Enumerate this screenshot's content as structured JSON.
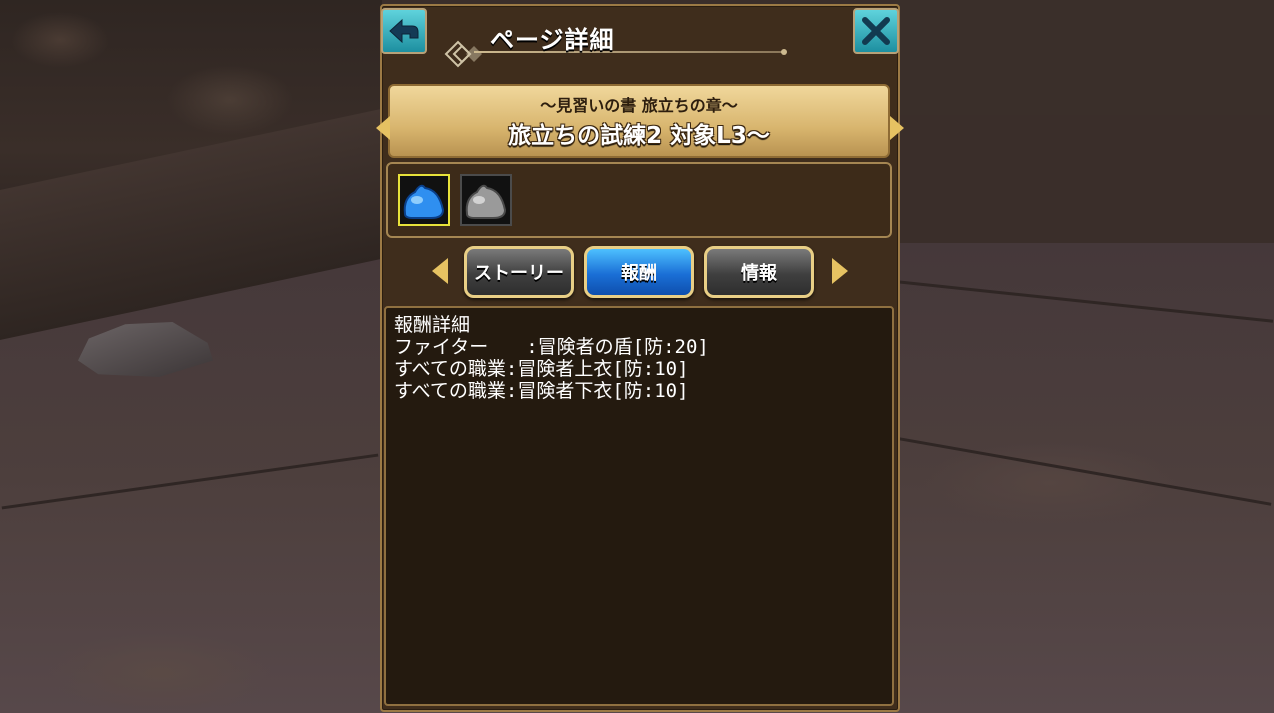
{
  "header": {
    "title": "ページ詳細",
    "back_icon": "back-arrow-icon",
    "close_icon": "close-icon"
  },
  "banner": {
    "subtitle": "〜見習いの書 旅立ちの章〜",
    "title": "旅立ちの試練2 対象L3〜"
  },
  "icons": [
    {
      "name": "blue-slime-icon",
      "color": "#2f8ff0",
      "selected": true
    },
    {
      "name": "gray-slime-icon",
      "color": "#9a9a9a",
      "selected": false
    }
  ],
  "tabs": [
    {
      "label": "ストーリー",
      "active": false
    },
    {
      "label": "報酬",
      "active": true
    },
    {
      "label": "情報",
      "active": false
    }
  ],
  "content": {
    "heading": "報酬詳細",
    "lines": [
      "ファイター　　:冒険者の盾[防:20]",
      "すべての職業:冒険者上衣[防:10]",
      "すべての職業:冒険者下衣[防:10]"
    ]
  },
  "colors": {
    "accent_gold": "#e6c262",
    "active_tab": "#1a6fd6",
    "panel_bg": "#3f2d1c"
  }
}
